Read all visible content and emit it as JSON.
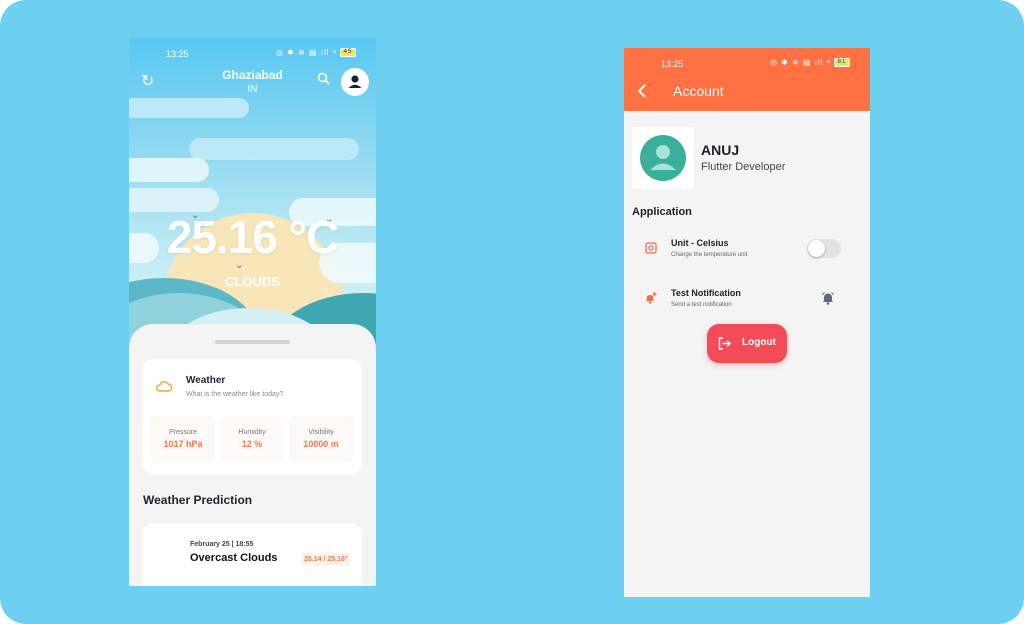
{
  "weather_screen": {
    "status_time": "13:25",
    "battery": "45",
    "city": "Ghaziabad",
    "country": "IN",
    "temperature": "25.16 °C",
    "condition": "CLOUDS",
    "weather_card": {
      "title": "Weather",
      "subtitle": "What is the weather like today?",
      "stats": [
        {
          "label": "Pressure",
          "value": "1017 hPa"
        },
        {
          "label": "Humidity",
          "value": "12 %"
        },
        {
          "label": "Visibility",
          "value": "10000 m"
        }
      ]
    },
    "prediction": {
      "heading": "Weather Prediction",
      "date": "February 25 | 18:55",
      "condition": "Overcast Clouds",
      "range": "25.14 / 25.16°"
    },
    "accent_color": "#f07a52"
  },
  "account_screen": {
    "status_time": "13:25",
    "battery": "81",
    "title": "Account",
    "user_name": "ANUJ",
    "user_role": "Flutter Developer",
    "section": "Application",
    "settings": [
      {
        "title": "Unit - Celsius",
        "subtitle": "Change the temperature unit",
        "icon": "thermometer-icon",
        "control": "toggle-off"
      },
      {
        "title": "Test Notification",
        "subtitle": "Send a test notification",
        "icon": "notification-add-icon",
        "control": "bell-icon"
      }
    ],
    "logout_label": "Logout",
    "appbar_color": "#ff7043",
    "logout_color": "#f24c59"
  }
}
